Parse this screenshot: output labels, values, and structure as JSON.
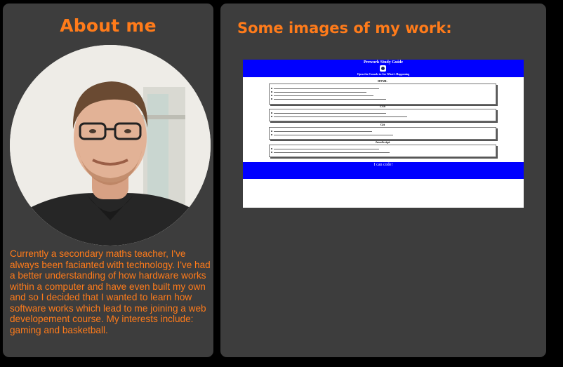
{
  "about": {
    "title": "About me",
    "description": "Currently a secondary maths teacher, I've always been facianted with technology. I've had a better understanding of how hardware works within a computer and have even built my own and so I decided that I wanted to learn how software works which lead to me joining a web developement course. My interests include: gaming and basketball."
  },
  "work": {
    "title": "Some images of my work:",
    "project": {
      "page_title": "Prework Study Guide",
      "subtitle": "Open the Console to See What's Happening",
      "sections": [
        {
          "title": "HTML",
          "lines": 4
        },
        {
          "title": "CSS",
          "lines": 2
        },
        {
          "title": "Git",
          "lines": 2
        },
        {
          "title": "JavaScript",
          "lines": 2
        }
      ],
      "footer": "I can code!"
    }
  },
  "colors": {
    "accent": "#ff7b1a",
    "panel": "#3d3d3d",
    "background": "#000000",
    "thumb_header": "#0000ff"
  }
}
